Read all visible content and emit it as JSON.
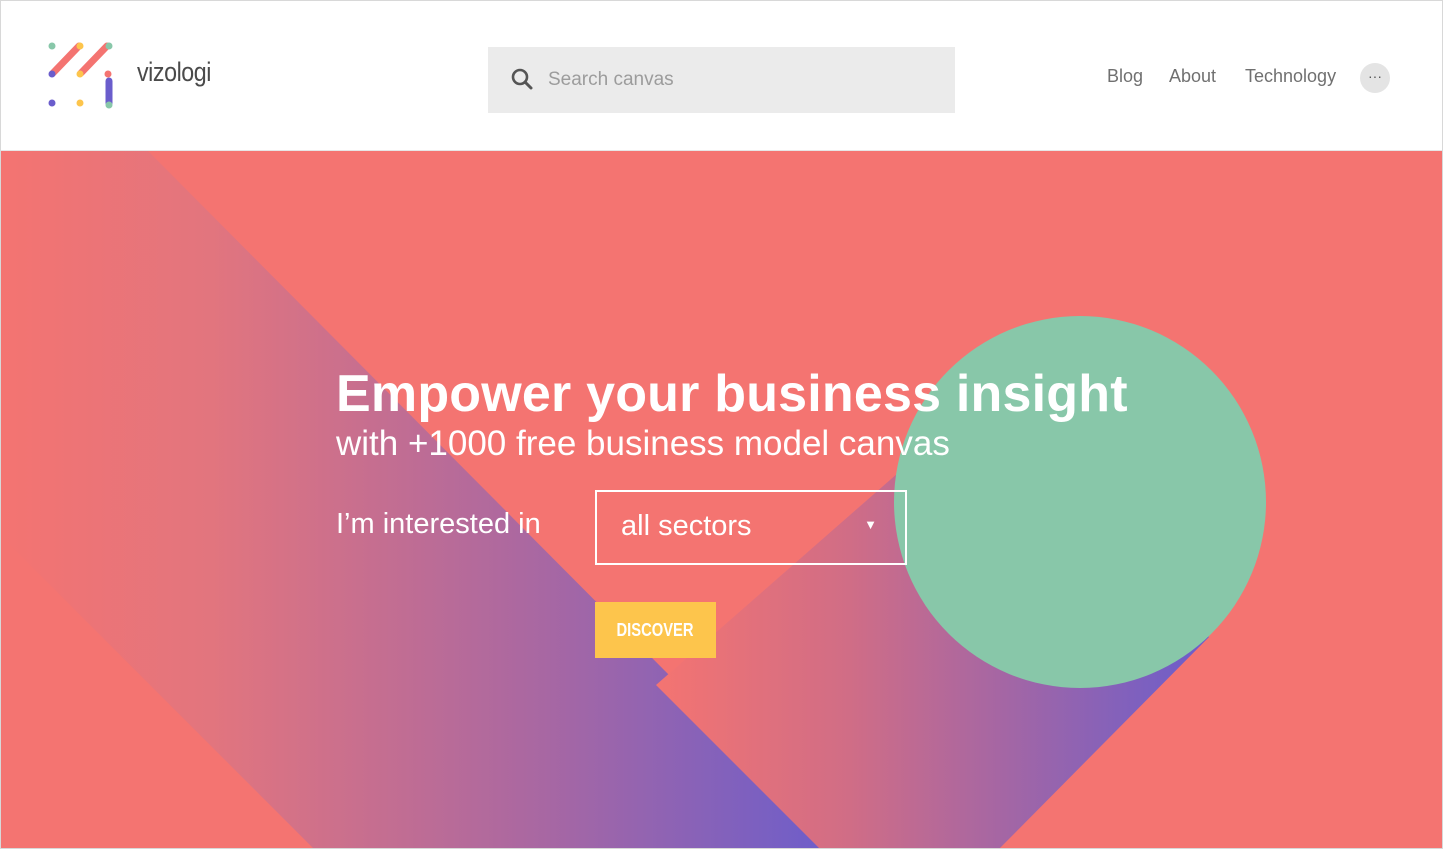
{
  "brand": {
    "name": "vizologi"
  },
  "search": {
    "placeholder": "Search canvas",
    "value": ""
  },
  "nav": [
    {
      "label": "Blog"
    },
    {
      "label": "About"
    },
    {
      "label": "Technology"
    }
  ],
  "more_label": "···",
  "hero": {
    "headline": "Empower your business insight",
    "subline": "with +1000 free business model canvas",
    "interest_label": "I’m interested in",
    "sector_selected": "all sectors",
    "dropdown_arrow": "▼",
    "cta_label": "DISCOVER"
  },
  "colors": {
    "hero_background": "#f47471",
    "circle": "#88c7a9",
    "gradient_purple": "#6a5dcc",
    "cta": "#fdc54c"
  },
  "icons": {
    "search": "search-icon",
    "logo": "logo-mark",
    "dropdown": "chevron-down-icon",
    "more": "more-icon"
  }
}
